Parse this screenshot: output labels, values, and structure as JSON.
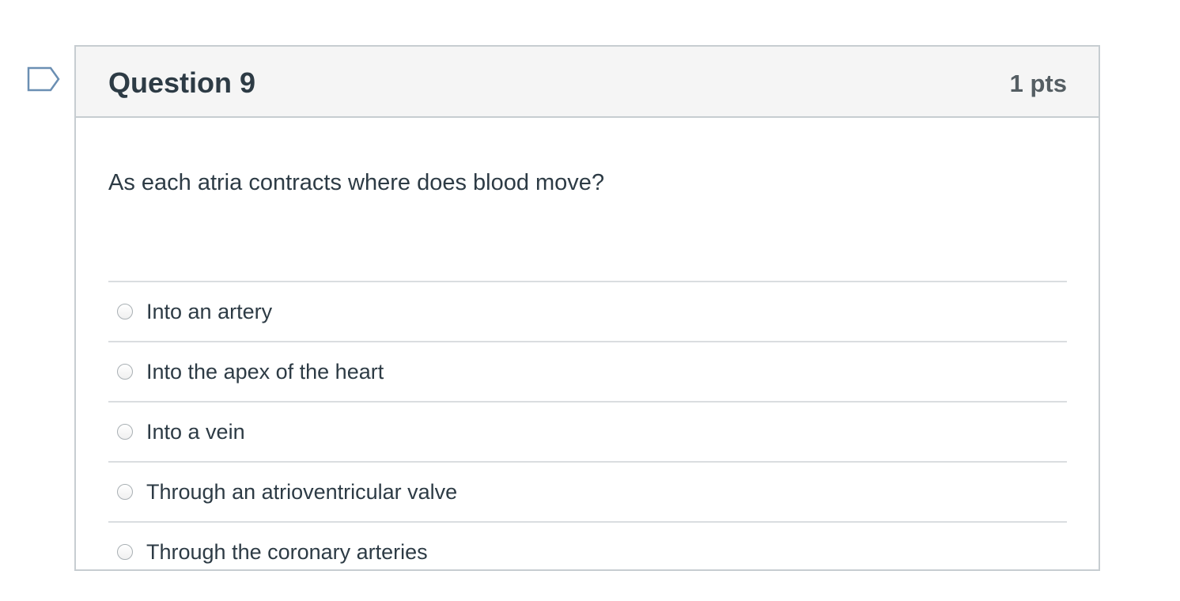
{
  "question": {
    "title": "Question 9",
    "points": "1 pts",
    "text": "As each atria contracts where does blood move?",
    "flag_icon": "bookmark-flag-icon",
    "answers": [
      {
        "label": "Into an artery"
      },
      {
        "label": "Into the apex of the heart"
      },
      {
        "label": "Into a vein"
      },
      {
        "label": "Through an atrioventricular valve"
      },
      {
        "label": "Through the coronary arteries"
      }
    ]
  },
  "colors": {
    "header_bg": "#f5f5f5",
    "border": "#c7cdd1",
    "text": "#2d3b45",
    "flag": "#6b8fb3"
  }
}
